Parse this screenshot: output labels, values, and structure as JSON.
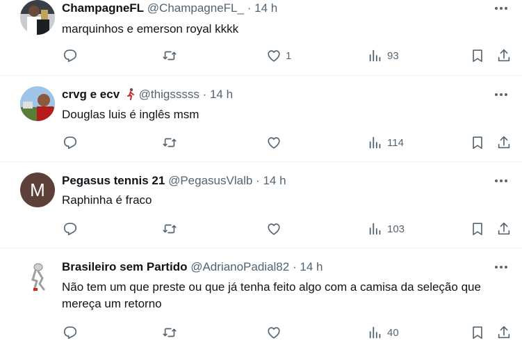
{
  "tweets": [
    {
      "name": "ChampagneFL",
      "handle": "@ChampagneFL_",
      "dot": "·",
      "time": "14 h",
      "text": "marquinhos e emerson royal kkkk",
      "likes": "1",
      "views": "93"
    },
    {
      "name": "crvg e ecv",
      "handle": "@thigsssss",
      "dot": "·",
      "time": "14 h",
      "text": "Douglas luis é inglês msm",
      "likes": "",
      "views": "114"
    },
    {
      "name": "Pegasus tennis 21",
      "handle": "@PegasusVlalb",
      "dot": "·",
      "time": "14 h",
      "avatar_letter": "M",
      "text": "Raphinha é fraco",
      "likes": "",
      "views": "103"
    },
    {
      "name": "Brasileiro sem Partido",
      "handle": "@AdrianoPadial82",
      "dot": "·",
      "time": "14 h",
      "text": "Não tem um que preste ou que já tenha feito algo com a camisa da seleção que mereça um retorno",
      "likes": "",
      "views": "40"
    }
  ],
  "colors": {
    "text": "#0f1419",
    "secondary": "#536471",
    "divider": "#eff3f4",
    "avatar_m_bg": "#5d4037"
  },
  "icons": [
    "reply-icon",
    "retweet-icon",
    "like-icon",
    "views-icon",
    "bookmark-icon",
    "share-icon",
    "more-icon"
  ]
}
